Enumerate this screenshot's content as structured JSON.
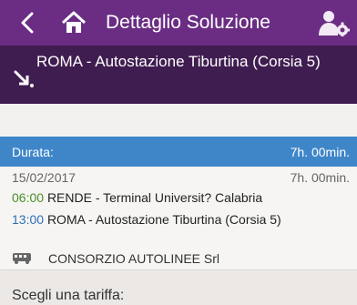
{
  "header": {
    "title": "Dettaglio Soluzione",
    "back_icon": "chevron-left-icon",
    "home_icon": "home-icon",
    "user_icon": "user-gear-icon"
  },
  "stop": {
    "icon": "arrow-down-right-icon",
    "label": "ROMA - Autostazione Tiburtina (Corsia 5)"
  },
  "duration": {
    "label": "Durata:",
    "value": "7h. 00min."
  },
  "trip": {
    "date": "15/02/2017",
    "duration": "7h. 00min.",
    "departure_time": "06:00",
    "departure_place": "RENDE - Terminal Universit? Calabria",
    "arrival_time": "13:00",
    "arrival_place": "ROMA - Autostazione Tiburtina (Corsia 5)",
    "company_icon": "bus-icon",
    "company": "CONSORZIO AUTOLINEE Srl"
  },
  "tariff": {
    "label": "Scegli una tariffa:"
  },
  "colors": {
    "header_bg": "#6a2d83",
    "stop_bg": "#401d50",
    "duration_bg": "#3f86c9",
    "departure_time": "#4b8f2a",
    "arrival_time": "#2f6fb7"
  }
}
